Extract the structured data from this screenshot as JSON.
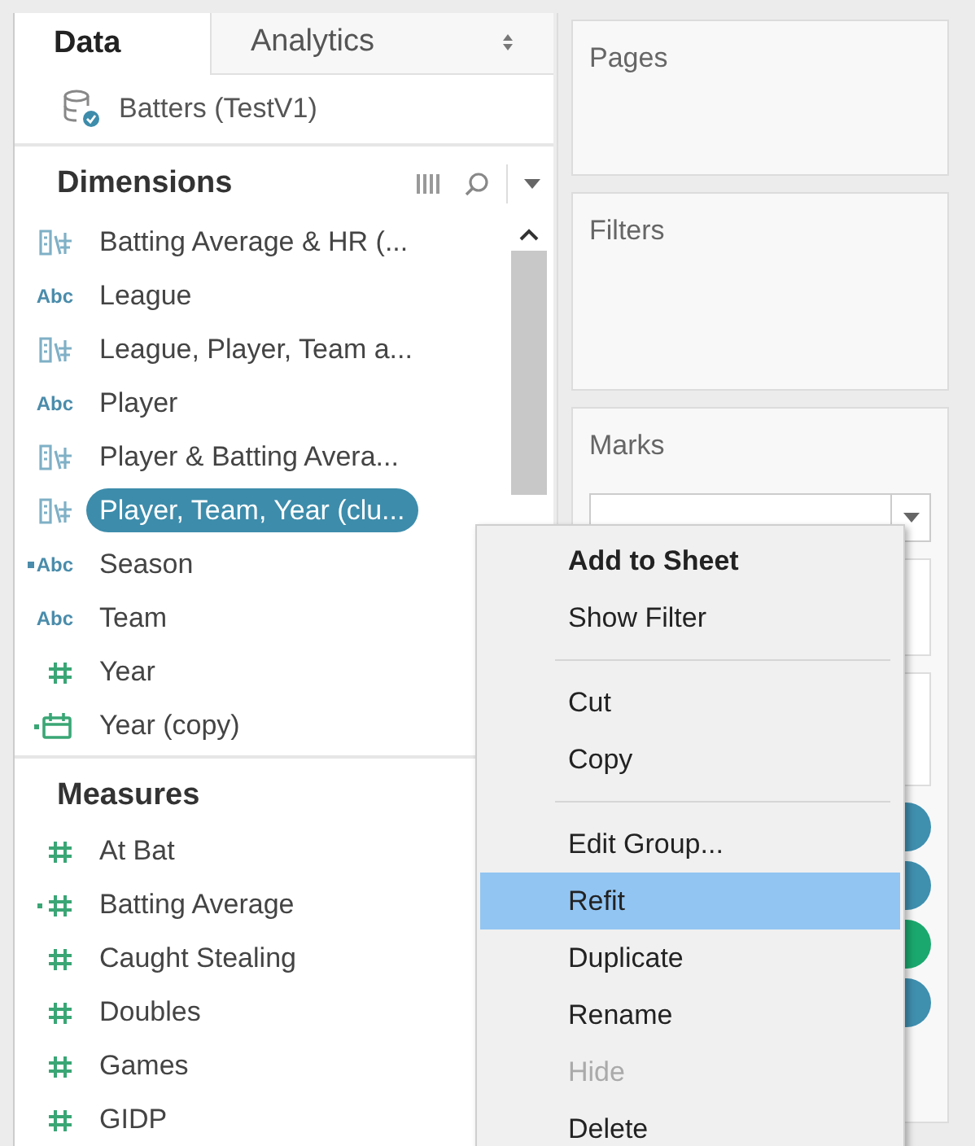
{
  "tabs": [
    {
      "label": "Data",
      "selected": true
    },
    {
      "label": "Analytics",
      "selected": false
    }
  ],
  "data_source": {
    "name": "Batters (TestV1)"
  },
  "dimensions": {
    "title": "Dimensions",
    "items": [
      {
        "kind": "group",
        "label": "Batting Average & HR (...",
        "selected": false
      },
      {
        "kind": "string",
        "icon_text": "Abc",
        "label": "League",
        "selected": false
      },
      {
        "kind": "group",
        "label": "League, Player, Team a...",
        "selected": false
      },
      {
        "kind": "string",
        "icon_text": "Abc",
        "label": "Player",
        "selected": false
      },
      {
        "kind": "group",
        "label": "Player & Batting Avera...",
        "selected": false
      },
      {
        "kind": "group",
        "label": "Player, Team, Year (clu...",
        "selected": true
      },
      {
        "kind": "string-calc",
        "icon_text": "Abc",
        "label": "Season",
        "selected": false
      },
      {
        "kind": "string",
        "icon_text": "Abc",
        "label": "Team",
        "selected": false
      },
      {
        "kind": "number",
        "label": "Year",
        "selected": false
      },
      {
        "kind": "date-calc",
        "label": "Year (copy)",
        "selected": false
      }
    ]
  },
  "measures": {
    "title": "Measures",
    "items": [
      {
        "kind": "number",
        "label": "At Bat",
        "selected": false
      },
      {
        "kind": "number-calc",
        "label": "Batting Average",
        "selected": false
      },
      {
        "kind": "number",
        "label": "Caught Stealing",
        "selected": false
      },
      {
        "kind": "number",
        "label": "Doubles",
        "selected": false
      },
      {
        "kind": "number",
        "label": "Games",
        "selected": false
      },
      {
        "kind": "number",
        "label": "GIDP",
        "selected": false
      }
    ]
  },
  "shelves": [
    {
      "title": "Pages"
    },
    {
      "title": "Filters"
    }
  ],
  "marks": {
    "title": "Marks",
    "pills": [
      {
        "color": "#3f8faf"
      },
      {
        "color": "#3f8faf"
      },
      {
        "color": "#1aa86e"
      },
      {
        "color": "#3f8faf"
      }
    ]
  },
  "context_menu": [
    {
      "kind": "item",
      "label": "Add to Sheet",
      "bold": true,
      "selected": false,
      "disabled": false
    },
    {
      "kind": "item",
      "label": "Show Filter",
      "bold": false,
      "selected": false,
      "disabled": false
    },
    {
      "kind": "separator"
    },
    {
      "kind": "item",
      "label": "Cut",
      "bold": false,
      "selected": false,
      "disabled": false
    },
    {
      "kind": "item",
      "label": "Copy",
      "bold": false,
      "selected": false,
      "disabled": false
    },
    {
      "kind": "separator"
    },
    {
      "kind": "item",
      "label": "Edit Group...",
      "bold": false,
      "selected": false,
      "disabled": false
    },
    {
      "kind": "item",
      "label": "Refit",
      "bold": false,
      "selected": true,
      "disabled": false
    },
    {
      "kind": "item",
      "label": "Duplicate",
      "bold": false,
      "selected": false,
      "disabled": false
    },
    {
      "kind": "item",
      "label": "Rename",
      "bold": false,
      "selected": false,
      "disabled": false
    },
    {
      "kind": "item",
      "label": "Hide",
      "bold": false,
      "selected": false,
      "disabled": true
    },
    {
      "kind": "item",
      "label": "Delete",
      "bold": false,
      "selected": false,
      "disabled": false
    }
  ]
}
